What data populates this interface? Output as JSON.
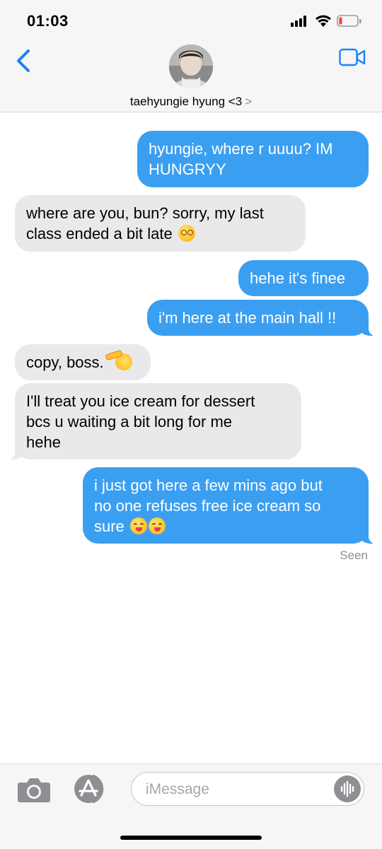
{
  "status_bar": {
    "time": "01:03",
    "signal_icon": "cellular-signal-icon",
    "wifi_icon": "wifi-icon",
    "battery_icon": "battery-low-icon",
    "battery_level": 0.12
  },
  "header": {
    "back_icon": "chevron-left-icon",
    "contact_name": "taehyungie hyung <3",
    "chevron": ">",
    "video_icon": "video-camera-icon"
  },
  "messages": [
    {
      "from": "me",
      "lines": [
        "hyungie, where r uuuu? IM",
        "HUNGRYY"
      ]
    },
    {
      "from": "them",
      "lines": [
        "where are you, bun? sorry, my last",
        "class ended a bit late"
      ],
      "emoji": "dizzy-face"
    },
    {
      "from": "me",
      "lines": [
        "hehe it's finee"
      ]
    },
    {
      "from": "me",
      "lines": [
        "i'm here at the main hall !!"
      ]
    },
    {
      "from": "them",
      "lines": [
        "copy, boss."
      ],
      "emoji": "saluting-face"
    },
    {
      "from": "them",
      "lines": [
        "I'll treat you ice cream for dessert",
        "bcs u waiting a bit long for me",
        "hehe"
      ]
    },
    {
      "from": "me",
      "lines": [
        "i just got here a few mins ago but",
        "no one refuses free ice cream so",
        "sure"
      ],
      "emoji": "yum-face x2"
    }
  ],
  "read_receipt": "Seen",
  "input_bar": {
    "camera_icon": "camera-icon",
    "appstore_icon": "app-store-icon",
    "placeholder": "iMessage",
    "value": "",
    "audio_icon": "audio-waveform-icon"
  },
  "colors": {
    "sent_bubble": "#3b9ff1",
    "received_bubble": "#e9e9ec",
    "accent": "#1a82fb",
    "bar_background": "#f6f6f7"
  }
}
